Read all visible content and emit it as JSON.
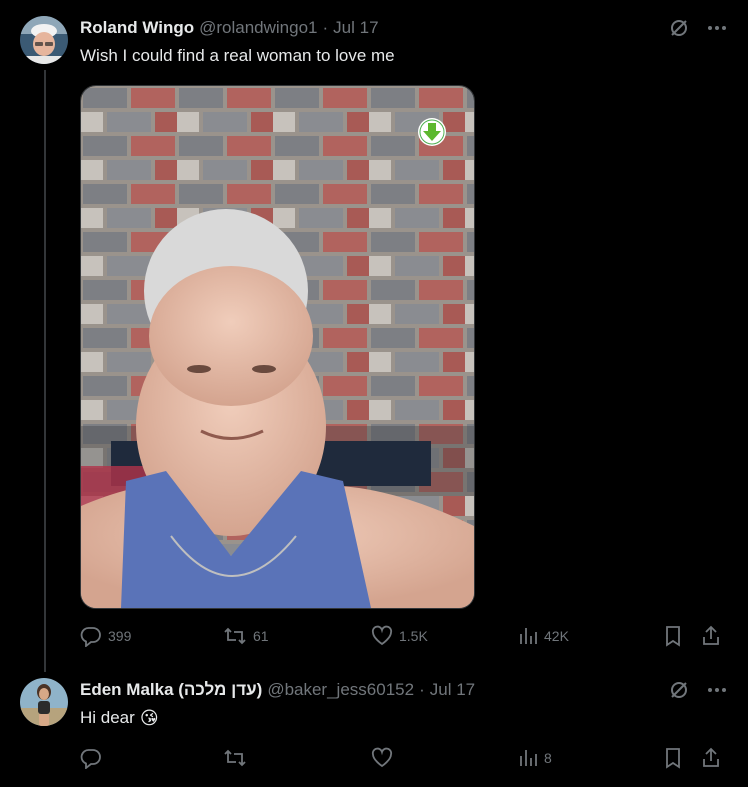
{
  "tweets": [
    {
      "name": "Roland Wingo",
      "handle": "@rolandwingo1",
      "date": "Jul 17",
      "text": "Wish I could find a real woman to love me",
      "stats": {
        "replies": "399",
        "retweets": "61",
        "likes": "1.5K",
        "views": "42K"
      }
    },
    {
      "name": "Eden Malka (עדן מלכה)",
      "handle": "@baker_jess60152",
      "date": "Jul 17",
      "text": "Hi dear",
      "emoji": "😘",
      "stats": {
        "replies": "",
        "retweets": "",
        "likes": "",
        "views": "8"
      }
    }
  ],
  "separator": "·",
  "icons": [
    "grok-icon",
    "more-icon",
    "reply-icon",
    "retweet-icon",
    "like-icon",
    "views-icon",
    "bookmark-icon",
    "share-icon",
    "download-icon"
  ],
  "colors": {
    "background": "#000000",
    "text": "#e7e9ea",
    "muted": "#71767b",
    "divider": "#333639"
  }
}
